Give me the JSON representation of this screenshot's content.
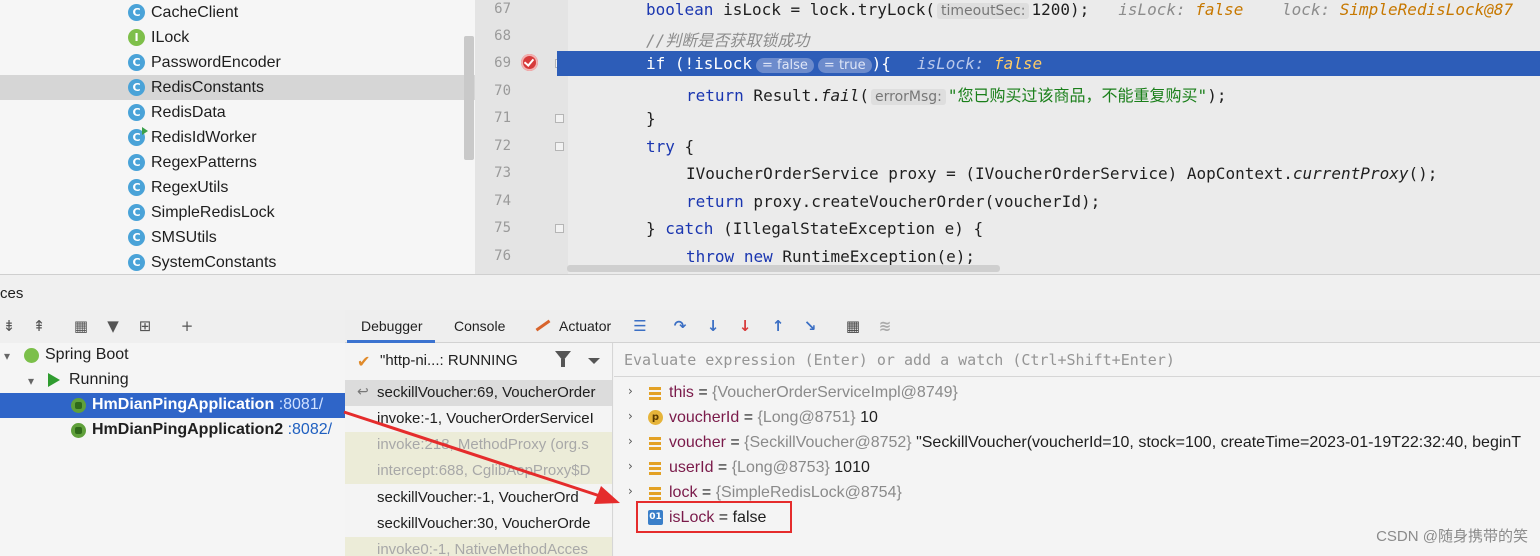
{
  "project_tree": {
    "items": [
      {
        "label": "CacheClient",
        "kind": "C"
      },
      {
        "label": "ILock",
        "kind": "I"
      },
      {
        "label": "PasswordEncoder",
        "kind": "C"
      },
      {
        "label": "RedisConstants",
        "kind": "C"
      },
      {
        "label": "RedisData",
        "kind": "C"
      },
      {
        "label": "RedisIdWorker",
        "kind": "C"
      },
      {
        "label": "RegexPatterns",
        "kind": "C"
      },
      {
        "label": "RegexUtils",
        "kind": "C"
      },
      {
        "label": "SimpleRedisLock",
        "kind": "C"
      },
      {
        "label": "SMSUtils",
        "kind": "C"
      },
      {
        "label": "SystemConstants",
        "kind": "C"
      }
    ]
  },
  "editor": {
    "line_numbers": [
      "67",
      "68",
      "69",
      "70",
      "71",
      "72",
      "73",
      "74",
      "75",
      "76"
    ],
    "line67": {
      "kw": "boolean",
      "text": " isLock = lock.tryLock(",
      "hint": "timeoutSec:",
      "tail": "1200);",
      "inl1_name": "isLock:",
      "inl1_val": "false",
      "inl2_name": "lock:",
      "inl2_val": "SimpleRedisLock@87"
    },
    "line68": {
      "comment": "//判断是否获取锁成功"
    },
    "line69": {
      "head": "if (!isLock",
      "pill1": "= false",
      "pill2": "= true",
      "tail": "){",
      "inl_name": "isLock:",
      "inl_val": "false"
    },
    "line70": {
      "kw": "return",
      "mid": " Result.",
      "method": "fail",
      "open": "(",
      "hint": "errorMsg:",
      "str": "\"您已购买过该商品，不能重复购买\"",
      "tail": ");"
    },
    "line71": {
      "text": "}"
    },
    "line72": {
      "kw": "try",
      "tail": " {"
    },
    "line73": {
      "text": "IVoucherOrderService proxy = (IVoucherOrderService) AopContext.",
      "method": "currentProxy",
      "tail": "();"
    },
    "line74": {
      "kw": "return",
      "tail": " proxy.createVoucherOrder(voucherId);"
    },
    "line75": {
      "head": "} ",
      "kw": "catch",
      "tail": " (IllegalStateException e) {"
    },
    "line76": {
      "kw1": "throw",
      "kw2": "new",
      "tail": " RuntimeException(e);"
    }
  },
  "services": {
    "title": "ces",
    "tree": {
      "spring_boot": "Spring Boot",
      "running": "Running",
      "apps": [
        {
          "name": "HmDianPingApplication",
          "port": ":8081/"
        },
        {
          "name": "HmDianPingApplication2",
          "port": ":8082/"
        }
      ]
    }
  },
  "debugger": {
    "tabs": [
      "Debugger",
      "Console",
      "Actuator"
    ],
    "thread": "\"http-ni...: RUNNING",
    "frames": [
      {
        "text": "seckillVoucher:69, VoucherOrder",
        "style": "current"
      },
      {
        "text": "invoke:-1, VoucherOrderServiceI",
        "style": "normal"
      },
      {
        "text": "invoke:218, MethodProxy (org.s",
        "style": "lib"
      },
      {
        "text": "intercept:688, CglibAopProxy$D",
        "style": "lib"
      },
      {
        "text": "seckillVoucher:-1, VoucherOrd",
        "style": "normal"
      },
      {
        "text": "seckillVoucher:30, VoucherOrde",
        "style": "normal"
      },
      {
        "text": "invoke0:-1, NativeMethodAcces",
        "style": "lib"
      }
    ],
    "watch_placeholder": "Evaluate expression (Enter) or add a watch (Ctrl+Shift+Enter)",
    "variables": [
      {
        "name": "this",
        "eq": " = ",
        "ref": "{VoucherOrderServiceImpl@8749}",
        "val": "",
        "icon": "field",
        "expand": true
      },
      {
        "name": "voucherId",
        "eq": " = ",
        "ref": "{Long@8751}",
        "val": " 10",
        "icon": "param",
        "expand": true
      },
      {
        "name": "voucher",
        "eq": " = ",
        "ref": "{SeckillVoucher@8752}",
        "val": " \"SeckillVoucher(voucherId=10, stock=100, createTime=2023-01-19T22:32:40, beginT",
        "icon": "field",
        "expand": true
      },
      {
        "name": "userId",
        "eq": " = ",
        "ref": "{Long@8753}",
        "val": " 1010",
        "icon": "field",
        "expand": true
      },
      {
        "name": "lock",
        "eq": " = ",
        "ref": "{SimpleRedisLock@8754}",
        "val": "",
        "icon": "field",
        "expand": true
      },
      {
        "name": "isLock",
        "eq": " = ",
        "ref": "",
        "val": "false",
        "icon": "01",
        "expand": false
      }
    ]
  },
  "watermark": "CSDN @随身携带的笑",
  "colors": {
    "exec_line": "#2d5db8",
    "selection": "#2f65c8",
    "annotation": "#e52c2c"
  }
}
